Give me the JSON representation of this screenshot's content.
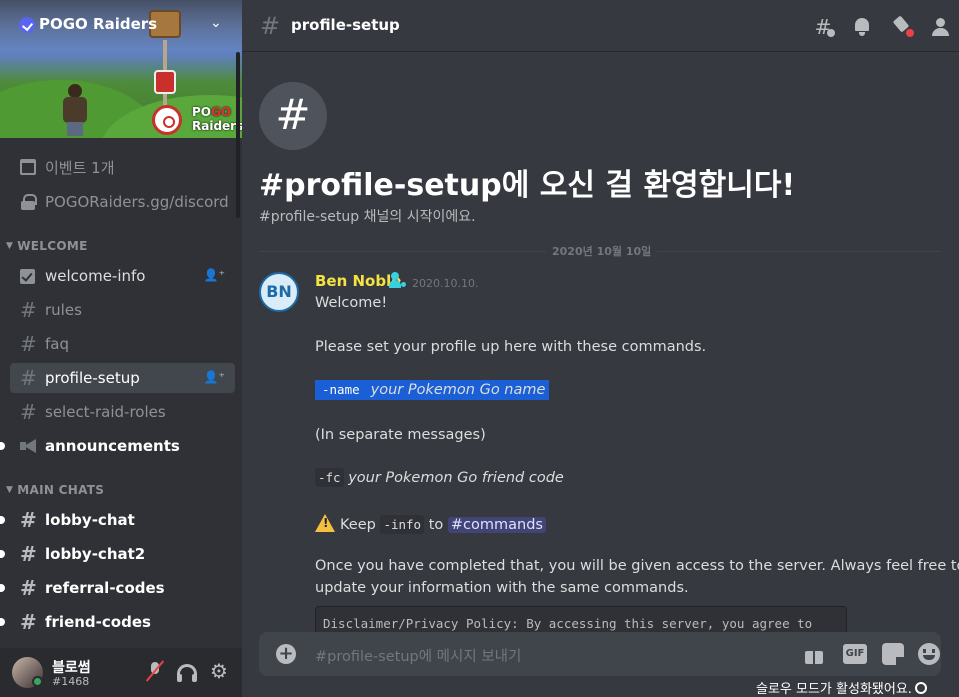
{
  "server": {
    "name": "POGO Raiders",
    "logo_text_a": "PO",
    "logo_text_b": "GO",
    "logo_text_c": "Raiders"
  },
  "sidebar_info": {
    "events": "이벤트 1개",
    "invite": "POGORaiders.gg/discord"
  },
  "categories": {
    "welcome": "WELCOME",
    "main_chats": "MAIN CHATS"
  },
  "channels": {
    "welcome_info": "welcome-info",
    "rules": "rules",
    "faq": "faq",
    "profile_setup": "profile-setup",
    "select_raid_roles": "select-raid-roles",
    "announcements": "announcements",
    "lobby_chat": "lobby-chat",
    "lobby_chat2": "lobby-chat2",
    "referral_codes": "referral-codes",
    "friend_codes": "friend-codes"
  },
  "user": {
    "name": "블로썸",
    "tag": "#1468"
  },
  "header": {
    "channel": "profile-setup"
  },
  "intro": {
    "title": "#profile-setup에 오신 걸 환영합니다!",
    "subtitle": "#profile-setup 채널의 시작이에요."
  },
  "date_divider": "2020년 10월 10일",
  "message": {
    "avatar_initials": "BN",
    "author": "Ben Noble",
    "timestamp": "2020.10.10.",
    "l1": "Welcome!",
    "l2": "Please set your profile up here with these commands.",
    "cmd_name": "-name",
    "cmd_name_arg": "your Pokemon Go name",
    "l4": "(In separate messages)",
    "cmd_fc": "-fc",
    "cmd_fc_arg": "your Pokemon Go friend code",
    "keep": "Keep",
    "cmd_info": "-info",
    "to": "to",
    "mention": "#commands",
    "l7a": "Once you have completed that, you will be given access to the server. Always feel free to",
    "l7b": "update your information with the same commands.",
    "codeblock": "Disclaimer/Privacy Policy: By accessing this server, you agree to"
  },
  "composer": {
    "placeholder": "#profile-setup에 메시지 보내기",
    "gif": "GIF"
  },
  "slowmode_notice": "슬로우 모드가 활성화됐어요."
}
